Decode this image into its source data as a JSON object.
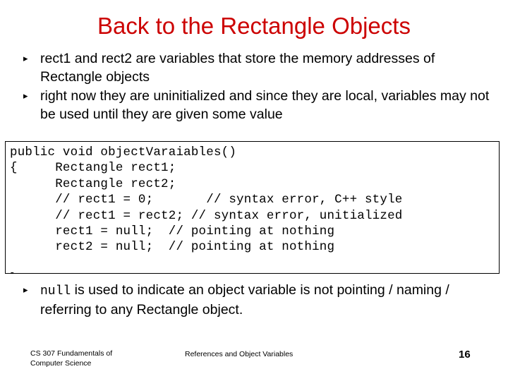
{
  "slide": {
    "title": "Back to the Rectangle Objects",
    "title_color": "#CC0000",
    "page_number": "16"
  },
  "bullet_marker": "▸",
  "bullets_top": [
    {
      "marker": "▸",
      "text": "rect1 and rect2 are variables that store the memory addresses of Rectangle objects"
    },
    {
      "marker": "▸",
      "text": "right now they are uninitialized and since they are local, variables may not be used until they are given some value"
    }
  ],
  "code_block": {
    "lines": [
      "public void objectVaraiables()",
      "{     Rectangle rect1;",
      "      Rectangle rect2;",
      "      // rect1 = 0;       // syntax error, C++ style",
      "      // rect1 = rect2; // syntax error, unitialized",
      "      rect1 = null;  // pointing at nothing",
      "      rect2 = null;  // pointing at nothing",
      "",
      "}"
    ],
    "text": "public void objectVaraiables()\n{     Rectangle rect1;\n      Rectangle rect2;\n      // rect1 = 0;       // syntax error, C++ style\n      // rect1 = rect2; // syntax error, unitialized\n      rect1 = null;  // pointing at nothing\n      rect2 = null;  // pointing at nothing\n\n}"
  },
  "bullets_bottom": [
    {
      "marker": "▸",
      "mono_lead": "null",
      "text": " is used to indicate an object variable is not pointing / naming / referring to any Rectangle object."
    }
  ],
  "footer": {
    "left": "CS 307 Fundamentals of\nComputer Science",
    "center": "References and Object Variables",
    "page": "16"
  }
}
